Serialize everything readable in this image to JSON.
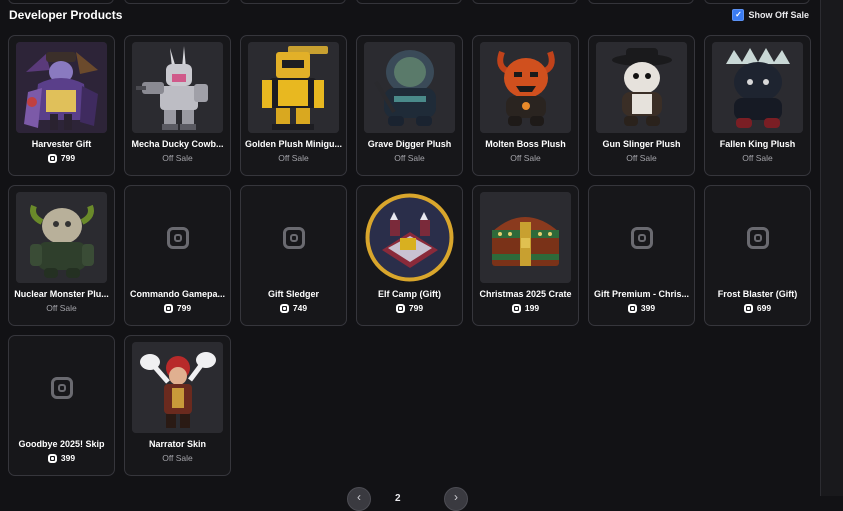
{
  "section": {
    "title": "Developer Products"
  },
  "toggle": {
    "label": "Show Off Sale",
    "checked": true,
    "check_glyph": "✓"
  },
  "currency": {
    "icon": "robux-icon"
  },
  "items": [
    {
      "name": "Harvester Gift",
      "status": "799",
      "on_sale": true,
      "image": "harvester-character-thumbnail"
    },
    {
      "name": "Mecha Ducky Cowb...",
      "status": "Off Sale",
      "on_sale": false,
      "image": "mecha-duck-thumbnail"
    },
    {
      "name": "Golden Plush Minigu...",
      "status": "Off Sale",
      "on_sale": false,
      "image": "golden-plush-thumbnail"
    },
    {
      "name": "Grave Digger Plush",
      "status": "Off Sale",
      "on_sale": false,
      "image": "grave-digger-plush-thumbnail"
    },
    {
      "name": "Molten Boss Plush",
      "status": "Off Sale",
      "on_sale": false,
      "image": "molten-boss-plush-thumbnail"
    },
    {
      "name": "Gun Slinger Plush",
      "status": "Off Sale",
      "on_sale": false,
      "image": "gun-slinger-plush-thumbnail"
    },
    {
      "name": "Fallen King Plush",
      "status": "Off Sale",
      "on_sale": false,
      "image": "fallen-king-plush-thumbnail"
    },
    {
      "name": "Nuclear Monster Plu...",
      "status": "Off Sale",
      "on_sale": false,
      "image": "nuclear-monster-plush-thumbnail"
    },
    {
      "name": "Commando Gamepa...",
      "status": "799",
      "on_sale": true,
      "image": "placeholder-icon"
    },
    {
      "name": "Gift Sledger",
      "status": "749",
      "on_sale": true,
      "image": "placeholder-icon"
    },
    {
      "name": "Elf Camp (Gift)",
      "status": "799",
      "on_sale": true,
      "image": "elf-camp-thumbnail"
    },
    {
      "name": "Christmas 2025 Crate",
      "status": "199",
      "on_sale": true,
      "image": "treasure-chest-thumbnail"
    },
    {
      "name": "Gift Premium - Chris...",
      "status": "399",
      "on_sale": true,
      "image": "placeholder-icon"
    },
    {
      "name": "Frost Blaster (Gift)",
      "status": "699",
      "on_sale": true,
      "image": "placeholder-icon"
    },
    {
      "name": "Goodbye 2025! Skip",
      "status": "399",
      "on_sale": true,
      "image": "placeholder-icon"
    },
    {
      "name": "Narrator Skin",
      "status": "Off Sale",
      "on_sale": false,
      "image": "narrator-character-thumbnail"
    }
  ],
  "pagination": {
    "prev_icon": "chevron-left-icon",
    "next_icon": "chevron-right-icon",
    "prev_glyph": "‹",
    "next_glyph": "›",
    "current": "2"
  },
  "colors": {
    "accent": "#3a7bf2",
    "elf_camp_ring": "#d9a62c",
    "background": "#121215"
  }
}
